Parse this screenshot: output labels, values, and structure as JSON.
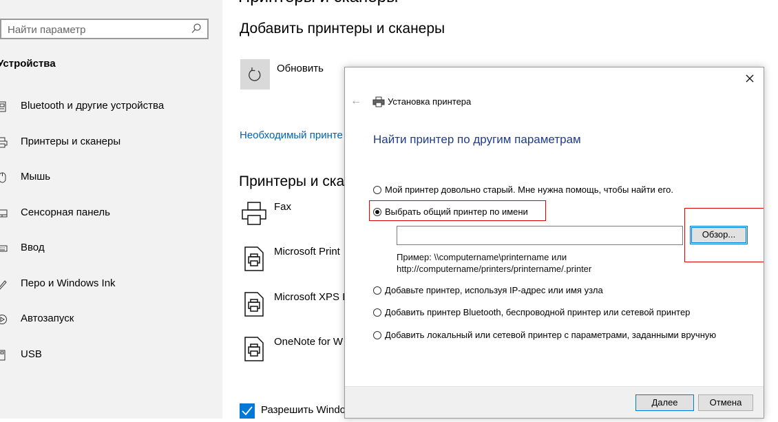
{
  "settings": {
    "page_title": "Принтеры и сканеры",
    "search": {
      "placeholder": "Найти параметр"
    },
    "group_title": "Устройства",
    "nav": [
      {
        "label": "Bluetooth и другие устройства",
        "icon": "bluetooth-devices-icon"
      },
      {
        "label": "Принтеры и сканеры",
        "icon": "printer-icon"
      },
      {
        "label": "Мышь",
        "icon": "mouse-icon"
      },
      {
        "label": "Сенсорная панель",
        "icon": "touchpad-icon"
      },
      {
        "label": "Ввод",
        "icon": "keyboard-icon"
      },
      {
        "label": "Перо и Windows Ink",
        "icon": "pen-icon"
      },
      {
        "label": "Автозапуск",
        "icon": "autoplay-icon"
      },
      {
        "label": "USB",
        "icon": "usb-icon"
      }
    ],
    "add_section_title": "Добавить принтеры и сканеры",
    "refresh_label": "Обновить",
    "missing_link": "Необходимый принте",
    "printers_section_title": "Принтеры и ска",
    "printers": [
      "Fax",
      "Microsoft Print",
      "Microsoft XPS D",
      "OneNote for W"
    ],
    "allow_label": "Разрешить Windo"
  },
  "dialog": {
    "title": "Установка принтера",
    "heading": "Найти принтер по другим параметрам",
    "options": [
      "Мой принтер довольно старый. Мне нужна помощь, чтобы найти его.",
      "Выбрать общий принтер по имени",
      "Добавьте принтер, используя IP-адрес или имя узла",
      "Добавить принтер Bluetooth, беспроводной принтер или сетевой принтер",
      "Добавить локальный или сетевой принтер с параметрами, заданными вручную"
    ],
    "selected_option": 1,
    "name_value": "",
    "browse_label": "Обзор...",
    "example_line1": "Пример: \\\\computername\\printername или",
    "example_line2": "http://computername/printers/printername/.printer",
    "next_label": "Далее",
    "cancel_label": "Отмена"
  },
  "colors": {
    "accent": "#0078d7",
    "link": "#0063b1",
    "heading": "#1e3c8c",
    "highlight": "#dd0000"
  }
}
